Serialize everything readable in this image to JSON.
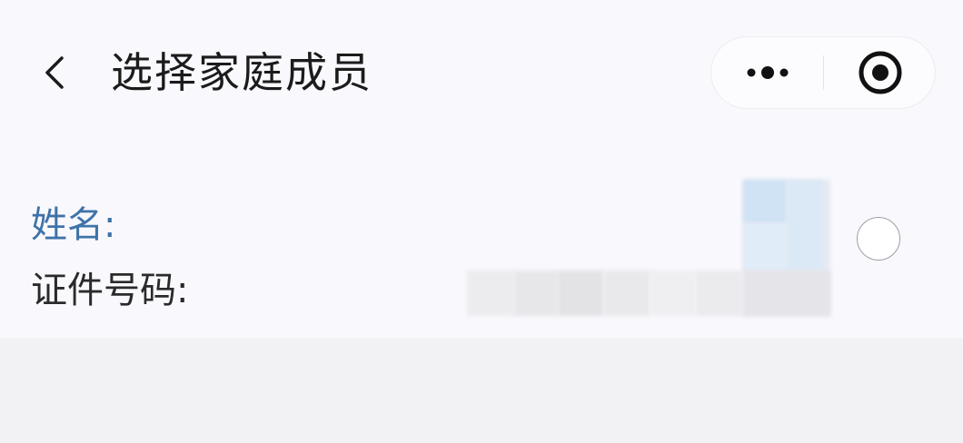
{
  "nav": {
    "title": "选择家庭成员",
    "back_icon": "chevron-left-icon",
    "more_icon": "more-dots-icon",
    "close_icon": "target-circle-icon"
  },
  "member": {
    "name_label": "姓名:",
    "id_label": "证件号码:",
    "selected": false
  },
  "colors": {
    "name_label": "#3f73a8",
    "text": "#1b1b1b",
    "background": "#f8f8fd",
    "bottom_area": "#f2f2f4"
  }
}
